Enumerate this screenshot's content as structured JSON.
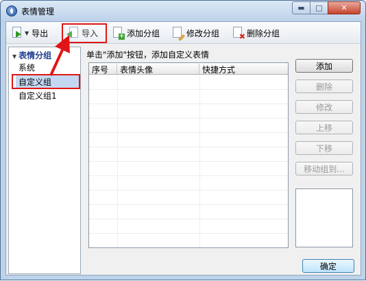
{
  "window": {
    "title": "表情管理"
  },
  "toolbar": {
    "export_label": "导出",
    "import_label": "导入",
    "add_group_label": "添加分组",
    "edit_group_label": "修改分组",
    "delete_group_label": "删除分组"
  },
  "sidebar": {
    "root_label": "表情分组",
    "items": [
      {
        "label": "系统"
      },
      {
        "label": "自定义组"
      },
      {
        "label": "自定义组1"
      }
    ]
  },
  "main": {
    "hint": "单击\"添加\"按钮，添加自定义表情",
    "columns": [
      "序号",
      "表情头像",
      "快捷方式"
    ]
  },
  "actions": {
    "add": "添加",
    "delete": "删除",
    "edit": "修改",
    "move_up": "上移",
    "move_down": "下移",
    "move_to_group": "移动组到..."
  },
  "footer": {
    "ok": "确定"
  },
  "colors": {
    "highlight_red": "#e01515",
    "selection_blue": "#c5d8f3"
  }
}
